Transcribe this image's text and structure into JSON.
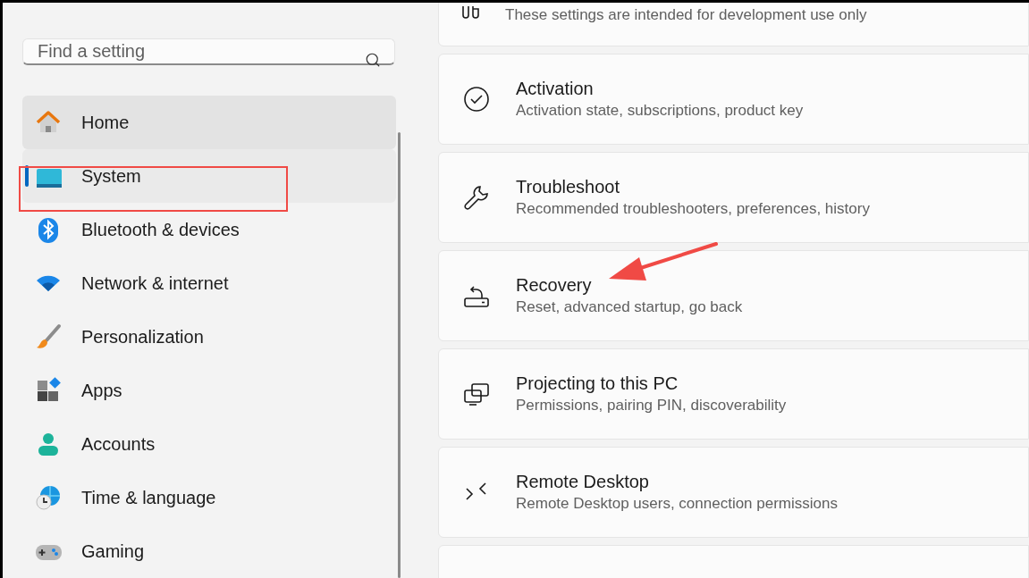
{
  "search": {
    "placeholder": "Find a setting"
  },
  "nav": [
    {
      "label": "Home",
      "selected": false,
      "hovered": true
    },
    {
      "label": "System",
      "selected": true,
      "hovered": false
    },
    {
      "label": "Bluetooth & devices",
      "selected": false,
      "hovered": false
    },
    {
      "label": "Network & internet",
      "selected": false,
      "hovered": false
    },
    {
      "label": "Personalization",
      "selected": false,
      "hovered": false
    },
    {
      "label": "Apps",
      "selected": false,
      "hovered": false
    },
    {
      "label": "Accounts",
      "selected": false,
      "hovered": false
    },
    {
      "label": "Time & language",
      "selected": false,
      "hovered": false
    },
    {
      "label": "Gaming",
      "selected": false,
      "hovered": false
    }
  ],
  "cards": [
    {
      "description": "These settings are intended for development use only"
    },
    {
      "title": "Activation",
      "description": "Activation state, subscriptions, product key"
    },
    {
      "title": "Troubleshoot",
      "description": "Recommended troubleshooters, preferences, history"
    },
    {
      "title": "Recovery",
      "description": "Reset, advanced startup, go back"
    },
    {
      "title": "Projecting to this PC",
      "description": "Permissions, pairing PIN, discoverability"
    },
    {
      "title": "Remote Desktop",
      "description": "Remote Desktop users, connection permissions"
    }
  ]
}
